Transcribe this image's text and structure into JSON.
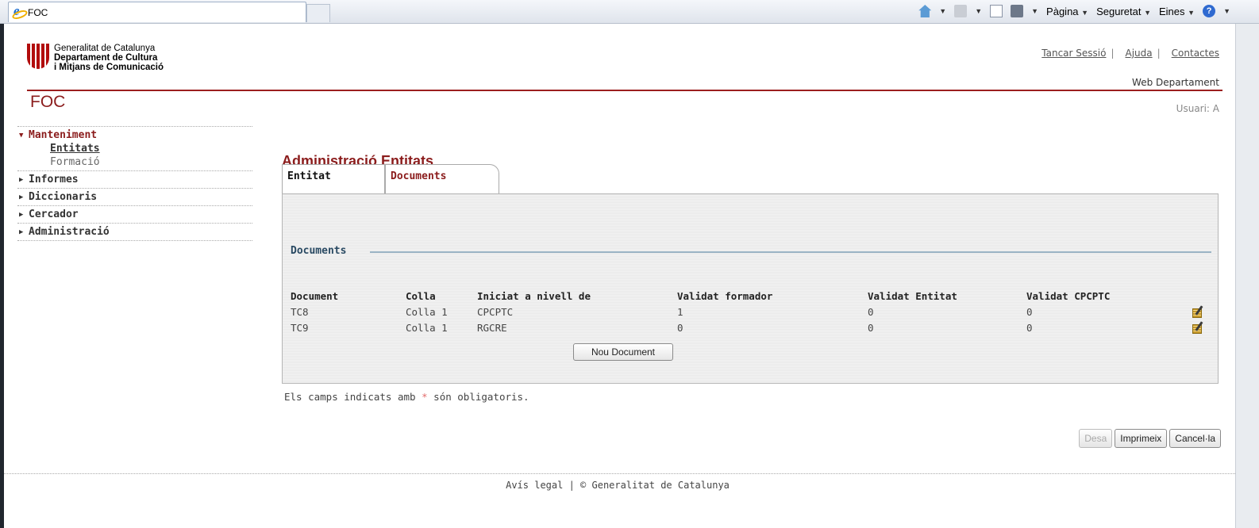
{
  "browser": {
    "tab_title": "FOC",
    "tools": {
      "pagina": "Pàgina",
      "seguretat": "Seguretat",
      "eines": "Eines"
    }
  },
  "header": {
    "logo": {
      "line1": "Generalitat de Catalunya",
      "line2": "Departament de Cultura",
      "line3": "i Mitjans de Comunicació"
    },
    "links": {
      "logout": "Tancar Sessió",
      "help": "Ajuda",
      "contact": "Contactes"
    },
    "web_departament": "Web Departament",
    "app_title": "FOC",
    "user": "Usuari: A"
  },
  "sidebar": {
    "groups": [
      {
        "label": "Manteniment",
        "open": true,
        "items": [
          {
            "label": "Entitats",
            "active": true
          },
          {
            "label": "Formació",
            "active": false
          }
        ]
      },
      {
        "label": "Informes",
        "open": false
      },
      {
        "label": "Diccionaris",
        "open": false
      },
      {
        "label": "Cercador",
        "open": false
      },
      {
        "label": "Administració",
        "open": false
      }
    ]
  },
  "main": {
    "heading": "Administració Entitats",
    "tabs": [
      "Entitat",
      "Documents"
    ],
    "fieldset_legend": "Documents",
    "table": {
      "headers": [
        "Document",
        "Colla",
        "Iniciat a nivell de",
        "Validat formador",
        "Validat Entitat",
        "Validat CPCPTC"
      ],
      "rows": [
        [
          "TC8",
          "Colla 1",
          "CPCPTC",
          "1",
          "0",
          "0"
        ],
        [
          "TC9",
          "Colla 1",
          "RGCRE",
          "0",
          "0",
          "0"
        ]
      ]
    },
    "new_document_button": "Nou Document",
    "required_note_pre": "Els camps indicats amb",
    "required_star": "*",
    "required_note_post": "són obligatoris.",
    "actions": {
      "save": "Desa",
      "print": "Imprimeix",
      "cancel": "Cancel·la"
    }
  },
  "footer": {
    "legal": "Avís legal",
    "copyright": "© Generalitat de Catalunya"
  }
}
